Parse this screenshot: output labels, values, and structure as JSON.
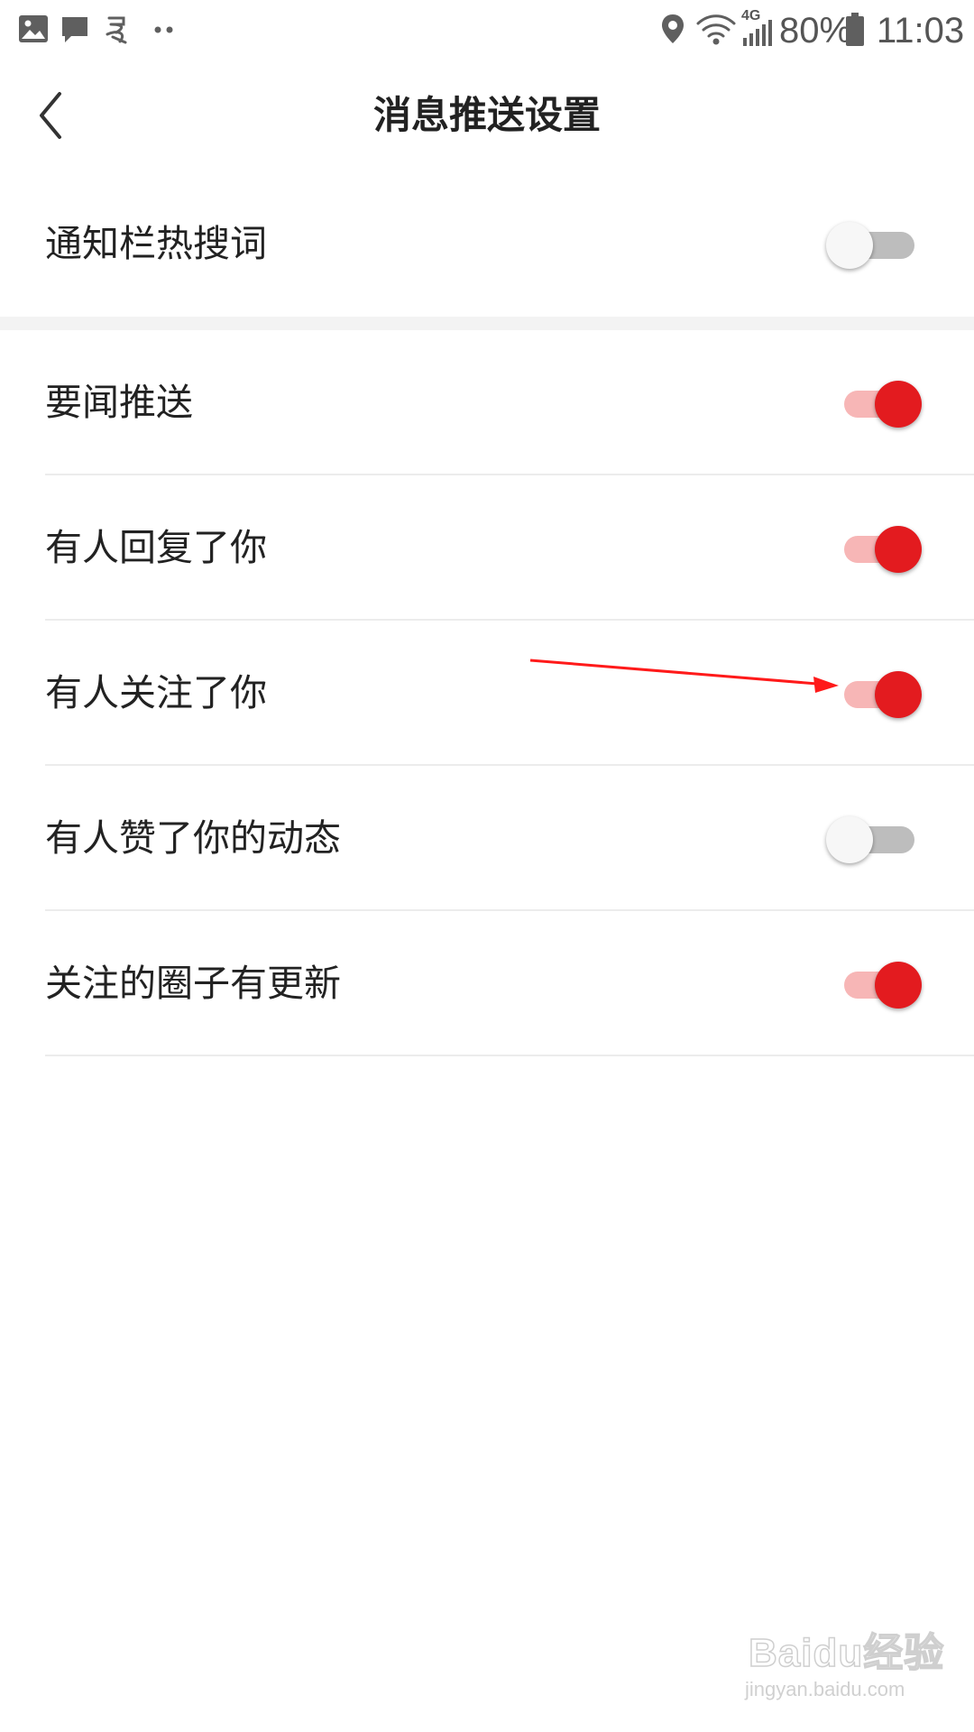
{
  "status_bar": {
    "left_icons": [
      "gallery-icon",
      "message-icon",
      "app-notification-icon",
      "more-dots-icon"
    ],
    "right_icons": [
      "location-icon",
      "wifi-icon",
      "signal-4g-icon",
      "battery-icon"
    ],
    "network_label": "4G",
    "battery_percent": "80%",
    "time": "11:03"
  },
  "header": {
    "back_icon": "back-chevron-icon",
    "title": "消息推送设置"
  },
  "settings": {
    "hot_search": {
      "label": "通知栏热搜词",
      "enabled": false
    },
    "items": [
      {
        "label": "要闻推送",
        "enabled": true
      },
      {
        "label": "有人回复了你",
        "enabled": true
      },
      {
        "label": "有人关注了你",
        "enabled": true
      },
      {
        "label": "有人赞了你的动态",
        "enabled": false
      },
      {
        "label": "关注的圈子有更新",
        "enabled": true
      }
    ]
  },
  "colors": {
    "switch_on_knob": "#e31b1f",
    "switch_on_track": "#f7b6b6",
    "switch_off_knob": "#f7f7f7",
    "switch_off_track": "#bdbdbd",
    "annotation_arrow": "#ff1a1a"
  },
  "watermark": {
    "logo": "Baidu经验",
    "url": "jingyan.baidu.com"
  }
}
